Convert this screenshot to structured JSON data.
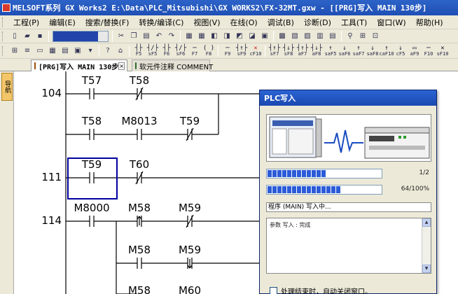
{
  "window": {
    "title": "MELSOFT系列 GX Works2 E:\\Data\\PLC_Mitsubishi\\GX WORKS2\\FX-32MT.gxw - [[PRG]写入 MAIN 130步]"
  },
  "menu": [
    "工程(P)",
    "编辑(E)",
    "搜索/替换(F)",
    "转换/编译(C)",
    "视图(V)",
    "在线(O)",
    "调试(B)",
    "诊断(D)",
    "工具(T)",
    "窗口(W)",
    "帮助(H)"
  ],
  "ladder_keys": [
    {
      "sym": "┤├",
      "label": "F5"
    },
    {
      "sym": "┤/├",
      "label": "sF5"
    },
    {
      "sym": "┤├",
      "label": "F6"
    },
    {
      "sym": "┤/├",
      "label": "sF6"
    },
    {
      "sym": "─",
      "label": "F7"
    },
    {
      "sym": "( )",
      "label": "F8"
    },
    {
      "sym": "─",
      "label": "F9"
    },
    {
      "sym": "┤↑├",
      "label": "sF9"
    },
    {
      "sym": "✕",
      "label": "cF10",
      "red": true
    },
    {
      "sym": "┤↑├",
      "label": "sF7"
    },
    {
      "sym": "┤↓├",
      "label": "sF8"
    },
    {
      "sym": "┤↑├",
      "label": "aF7"
    },
    {
      "sym": "┤↓├",
      "label": "aF8"
    },
    {
      "sym": "↑",
      "label": "saF5"
    },
    {
      "sym": "↓",
      "label": "saF6"
    },
    {
      "sym": "↑",
      "label": "saF7"
    },
    {
      "sym": "↓",
      "label": "saF8"
    },
    {
      "sym": "↑",
      "label": "caF10"
    },
    {
      "sym": "↓",
      "label": "cF5"
    },
    {
      "sym": "▭",
      "label": "aF9"
    },
    {
      "sym": "─",
      "label": "F10"
    },
    {
      "sym": "✕",
      "label": "sF10"
    }
  ],
  "tabs": [
    {
      "label": "[PRG]写入 MAIN 130步",
      "close": "×"
    },
    {
      "label": "软元件注释 COMMENT"
    }
  ],
  "side_tab": "导航",
  "ladder": {
    "steps": [
      "104",
      "111",
      "114"
    ],
    "contacts": [
      "T57",
      "T58",
      "T58",
      "M8013",
      "T59",
      "T59",
      "T60",
      "M8000",
      "M58",
      "M59",
      "M58",
      "M59",
      "M58",
      "M60"
    ]
  },
  "dialog": {
    "title": "PLC写入",
    "progress1": {
      "value": 0.5,
      "label": "1/2"
    },
    "progress2": {
      "value": 0.64,
      "label": "64/100%"
    },
    "status": "程序 (MAIN) 写入中...",
    "log": "参数 写入 : 完成",
    "auto_close_label": "处理结束时，自动关闭窗口。",
    "auto_close_checked": false
  },
  "colors": {
    "title_bar": "#1f4fb5",
    "progress": "#2b5bd7",
    "ladder_line": "#000000",
    "selection": "#0000a0"
  }
}
